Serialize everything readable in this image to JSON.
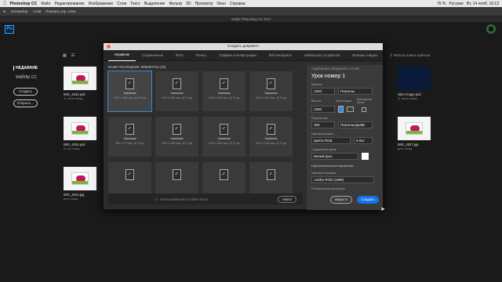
{
  "menubar": {
    "apple": "",
    "app": "Photoshop CC",
    "items": [
      "Файл",
      "Редактирование",
      "Изображение",
      "Слои",
      "Текст",
      "Выделение",
      "Фильтр",
      "3D",
      "Просмотр",
      "Окно",
      "Справка"
    ],
    "status": {
      "battery": "76 %",
      "lang": "Русские",
      "datetime": "Вт, 14 нояб. 16:13"
    }
  },
  "optbar": {
    "autoselect": "Автовыбор:",
    "layer": "Слой",
    "transform": "Показать упр. элем."
  },
  "tabbar": {
    "title": "Adobe Photoshop CC 2017"
  },
  "ps_logo": "Ps",
  "left": {
    "recent": "НЕДАВНИЕ",
    "cc_files": "ФАЙЛЫ CC",
    "create_btn": "Создать",
    "open_btn": "Открыть..."
  },
  "search_placeholder": "Фильтр новых файлов",
  "recent_files": [
    {
      "name": "IMG_4843.psd",
      "age": "11 часов назад"
    },
    {
      "name": "IMG_4815.psd",
      "age": "11 час назад"
    },
    {
      "name": "IMG_4813.jpg",
      "age": "день назад"
    },
    {
      "name": "viber image.psd",
      "age": "11 часов назад"
    },
    {
      "name": "IMG_4827.jpg",
      "age": "день назад"
    }
  ],
  "dialog": {
    "title": "Создать документ",
    "tabs": [
      "Недавние",
      "Сохраненные",
      "Фото",
      "Печать",
      "Графика и иллюстрации",
      "Веб-Интернета",
      "Мобильное устройство",
      "Фильмы и видео"
    ],
    "recent_heading": "ВАШИ ПОСЛЕДНИЕ ЭЛЕМЕНТЫ (20)",
    "presets": [
      {
        "name": "Заказная",
        "dim": "1920 x 1080 пикс. @ 300 ppi"
      },
      {
        "name": "Заказная",
        "dim": "1000 x 1000 пикс. @ 72 ppi"
      },
      {
        "name": "Заказная",
        "dim": "1000 x 1000 пикс. @ 72 ppi"
      },
      {
        "name": "Заказная",
        "dim": "1000 x 1000 пикс. @ 72 ppi"
      },
      {
        "name": "Заказная",
        "dim": "480 x 277 пикс. @ 72 ppi"
      },
      {
        "name": "Заказная",
        "dim": "1000 x 1000 пикс. @ 72 ppi"
      },
      {
        "name": "Заказная",
        "dim": "1000 x 1000 пикс. @ 72 ppi"
      },
      {
        "name": "Заказная",
        "dim": "1600 x 1200 пикс. @ 72 ppi"
      },
      {
        "name": "",
        "dim": ""
      },
      {
        "name": "",
        "dim": ""
      },
      {
        "name": "",
        "dim": ""
      },
      {
        "name": "",
        "dim": ""
      }
    ],
    "find_placeholder": "Поиск шаблонов в Adobe Stock",
    "find_button": "Найти",
    "details": {
      "header": "ПОДРОБНЫЕ СВЕДЕНИЯ О СТИЛЕ",
      "doc_name": "Урок номер 1",
      "width_label": "Ширина",
      "width": "1920",
      "width_unit": "Пикселы",
      "height_label": "Высота",
      "height": "1080",
      "orientation_label": "Ориентация",
      "artboards_label": "Монтажные облас",
      "resolution_label": "Разрешение",
      "resolution": "300",
      "resolution_unit": "Пикселы/дюйм",
      "color_mode_label": "Цветовой режим",
      "color_mode": "Цвета RGB",
      "bit_depth": "8 бит",
      "bg_label": "Содержимое фона",
      "bg_value": "Белый фон",
      "advanced": "Дополнительные параметры",
      "profile_label": "Цветовой профиль",
      "profile": "Adobe RGB (1998)",
      "pixel_aspect_label": "Попиксельная пропорция"
    },
    "cancel": "Закрыть",
    "create": "Создать"
  }
}
